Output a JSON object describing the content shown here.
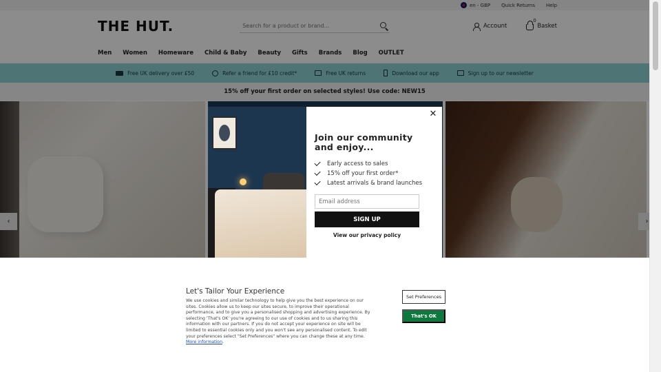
{
  "topbar": {
    "locale": "en - GBP",
    "quick_returns": "Quick Returns",
    "help": "Help"
  },
  "header": {
    "logo": "THE HUT.",
    "search_placeholder": "Search for a product or brand...",
    "account": "Account",
    "basket": "Basket",
    "basket_count": "0"
  },
  "nav": [
    "Men",
    "Women",
    "Homeware",
    "Child & Baby",
    "Beauty",
    "Gifts",
    "Brands",
    "Blog",
    "OUTLET"
  ],
  "usp": [
    {
      "icon": "truck-icon",
      "label": "Free UK delivery over £50"
    },
    {
      "icon": "refer-icon",
      "label": "Refer a friend for £10 credit*"
    },
    {
      "icon": "returns-icon",
      "label": "Free UK returns"
    },
    {
      "icon": "phone-icon",
      "label": "Download our app"
    },
    {
      "icon": "mail-icon",
      "label": "Sign up to our newsletter"
    }
  ],
  "promo": "15% off your first order on selected styles! Use code: NEW15",
  "carousel": {
    "prev": "‹",
    "next": "›"
  },
  "modal": {
    "close": "✕",
    "title": "Join our community and enjoy...",
    "benefits": [
      "Early access to sales",
      "15% off your first order*",
      "Latest arrivals & brand launches"
    ],
    "email_placeholder": "Email address",
    "signup": "SIGN UP",
    "privacy": "View our privacy policy"
  },
  "cookie": {
    "title": "Let's Tailor Your Experience",
    "text": "We use cookies and similar technology to help give you the best experience on our sites. Cookies allow us to keep our sites secure, to improve their operational performance, and to give you a personalised shopping and advertising experience. By selecting 'That's OK' you're agreeing to our use of cookies and to us sharing this information with our partners. If you do not accept your experience on site will be limited to essential cookies only and you won't see any personalised content. To edit your preferences select \"Set Preferences\" where you can change these at any time.",
    "more_info": "More information",
    "set_preferences": "Set Preferences",
    "thats_ok": "That's OK"
  },
  "colors": {
    "usp_bar": "#8fd3d6",
    "accept_button": "#0c7a3c",
    "signup_button": "#111111"
  }
}
